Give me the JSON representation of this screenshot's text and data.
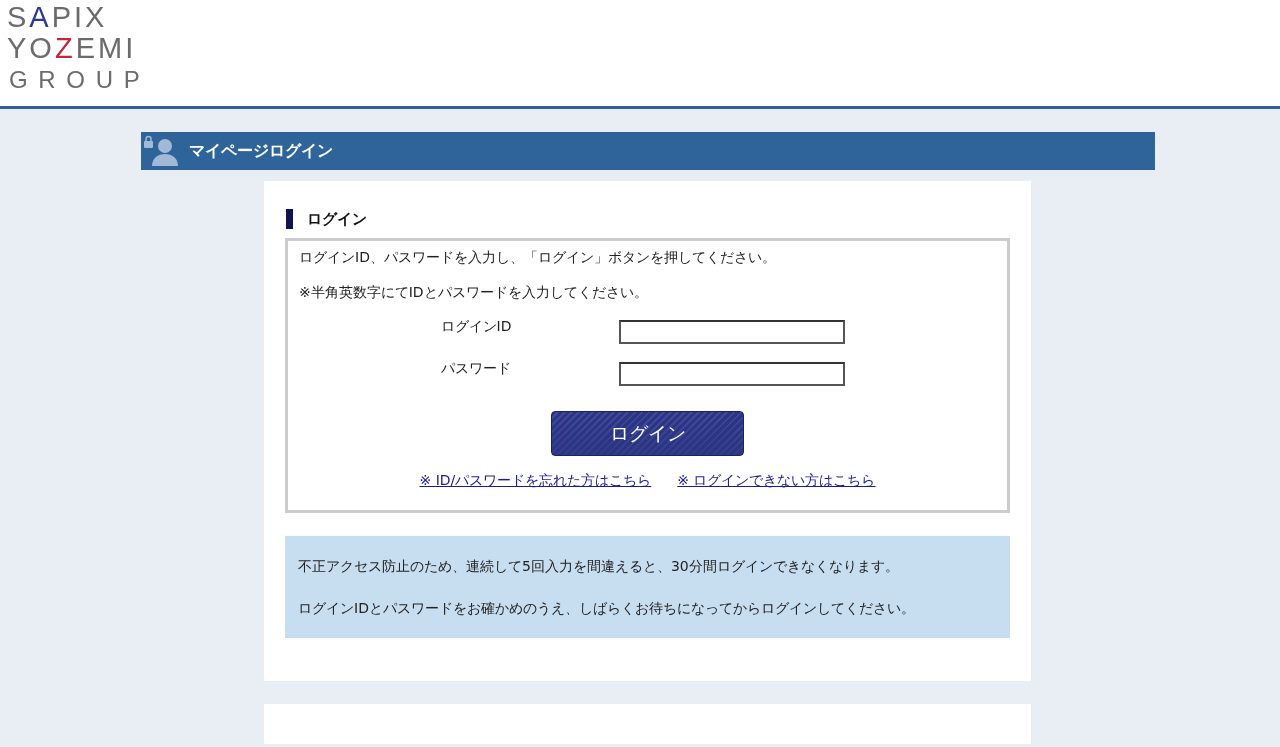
{
  "logo": {
    "lines": [
      {
        "parts": [
          {
            "text": "S"
          },
          {
            "text": "A",
            "color": "#2c3a8c"
          },
          {
            "text": "PIX"
          }
        ]
      },
      {
        "parts": [
          {
            "text": "YO"
          },
          {
            "text": "Z",
            "color": "#c0283c"
          },
          {
            "text": "EMI"
          }
        ]
      },
      {
        "parts": [
          {
            "text": "G R O U P"
          }
        ]
      }
    ]
  },
  "title_bar": {
    "title": "マイページログイン"
  },
  "login": {
    "heading": "ログイン",
    "instructions": [
      "ログインID、パスワードを入力し、「ログイン」ボタンを押してください。",
      "※半角英数字にてIDとパスワードを入力してください。"
    ],
    "fields": [
      {
        "label": "ログインID"
      },
      {
        "label": "パスワード"
      }
    ],
    "button": "ログイン",
    "links": [
      "※ ID/パスワードを忘れた方はこちら",
      "※ ログインできない方はこちら"
    ],
    "notices": [
      "不正アクセス防止のため、連続して5回入力を間違えると、30分間ログインできなくなります。",
      "ログインIDとパスワードをお確かめのうえ、しばらくお待ちになってからログインしてください。"
    ]
  }
}
